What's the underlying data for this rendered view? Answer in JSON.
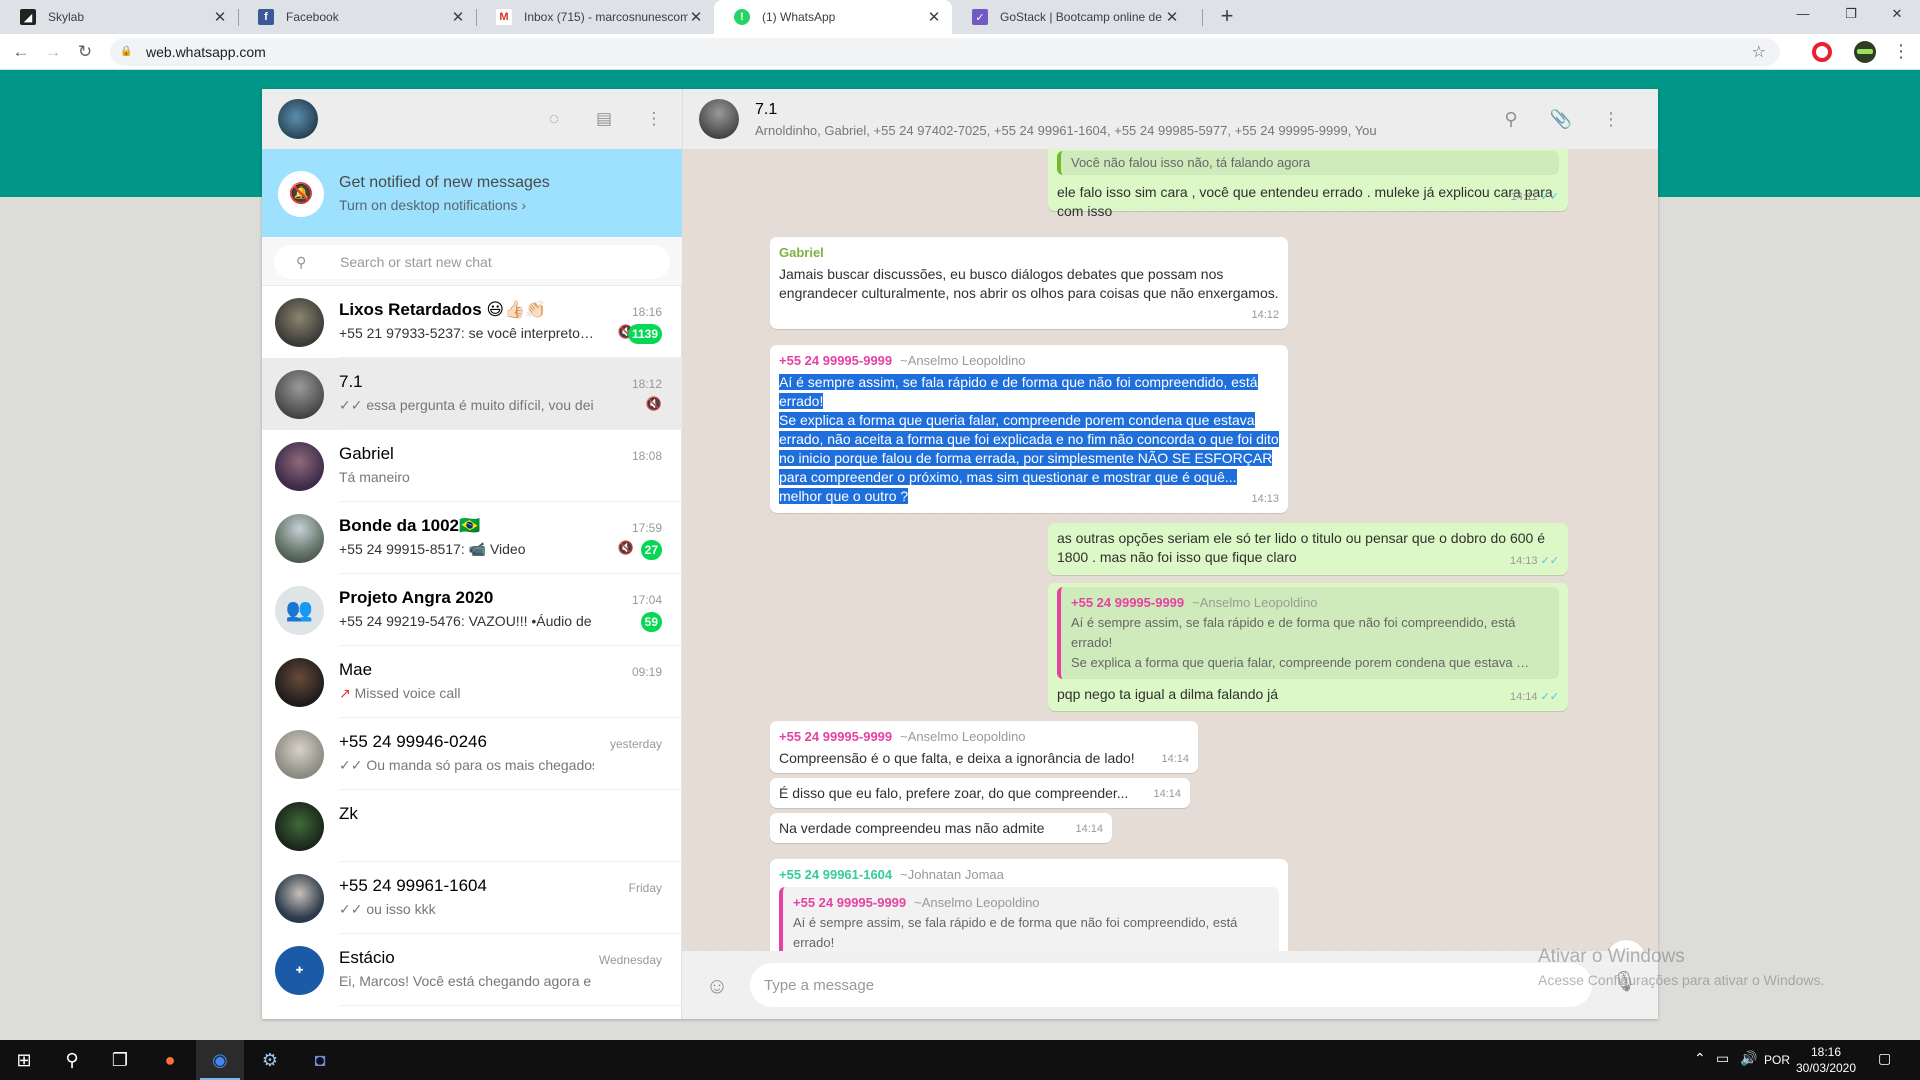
{
  "browser": {
    "tabs": [
      {
        "title": "Skylab",
        "favicon_color": "#222222",
        "favicon_char": "◢"
      },
      {
        "title": "Facebook",
        "favicon_color": "#3b5998",
        "favicon_char": "f"
      },
      {
        "title": "Inbox (715) - marcosnunescomer",
        "favicon_color": "#ffffff",
        "favicon_char": "M"
      },
      {
        "title": "(1) WhatsApp",
        "favicon_color": "#25d366",
        "favicon_char": "!"
      },
      {
        "title": "GoStack | Bootcamp online de N",
        "favicon_color": "#7159c1",
        "favicon_char": "✓"
      }
    ],
    "url": "web.whatsapp.com"
  },
  "sidebar": {
    "notification": {
      "title": "Get notified of new messages",
      "subtitle": "Turn on desktop notifications ›"
    },
    "search_placeholder": "Search or start new chat",
    "chats": [
      {
        "name": "Lixos Retardados 😃👍🏻👏🏻",
        "time": "18:16",
        "preview": "+55 21 97933-5237: se você interpreto…",
        "badge": "1139",
        "muted": true,
        "bold": true,
        "avatar_color": "#3b3a36"
      },
      {
        "name": "7.1",
        "time": "18:12",
        "preview": "✓✓ essa pergunta é muito difícil, vou deixar pa…",
        "badge": "",
        "muted": true,
        "bold": false,
        "avatar_color": "#6a6a6a"
      },
      {
        "name": "Gabriel",
        "time": "18:08",
        "preview": "Tá maneiro",
        "badge": "",
        "muted": false,
        "bold": false,
        "avatar_color": "#4b3a5a"
      },
      {
        "name": "Bonde da 1002🇧🇷",
        "time": "17:59",
        "preview": "+55 24 99915-8517: 📹 Video",
        "badge": "27",
        "muted": true,
        "bold": true,
        "avatar_color": "#7a8a7a"
      },
      {
        "name": "Projeto Angra 2020",
        "time": "17:04",
        "preview": "+55 24 99219-5476: VAZOU!!!   •Áudio de …",
        "badge": "59",
        "muted": false,
        "bold": true,
        "avatar_color": "#dfe5e7"
      },
      {
        "name": "Mae",
        "time": "09:19",
        "preview": "Missed voice call",
        "badge": "",
        "muted": false,
        "bold": false,
        "avatar_color": "#1c1c1c"
      },
      {
        "name": "+55 24 99946-0246",
        "time": "yesterday",
        "preview": "✓✓ Ou manda só para os mais chegados que voc…",
        "badge": "",
        "muted": false,
        "bold": false,
        "avatar_color": "#9aa1a8"
      },
      {
        "name": "Zk",
        "time": "",
        "preview": "",
        "badge": "",
        "muted": false,
        "bold": false,
        "avatar_color": "#2a3a2a"
      },
      {
        "name": "+55 24 99961-1604",
        "time": "Friday",
        "preview": "✓✓ ou isso kkk",
        "badge": "",
        "muted": false,
        "bold": false,
        "avatar_color": "#3a4a5a"
      },
      {
        "name": "Estácio",
        "time": "Wednesday",
        "preview": "Ei, Marcos!  Você está chegando agora e estamos…",
        "badge": "",
        "muted": false,
        "bold": false,
        "avatar_color": "#1b5aa6"
      }
    ]
  },
  "conversation": {
    "name": "7.1",
    "members": "Arnoldinho, Gabriel, +55 24 97402-7025, +55 24 99961-1604, +55 24 99985-5977, +55 24 99995-9999, You",
    "input_placeholder": "Type a message",
    "messages": {
      "m1": {
        "quote": "Você não falou isso não, tá falando agora",
        "text": "ele falo isso sim cara , você que entendeu errado . muleke já explicou cara para com isso",
        "time": "14:11"
      },
      "m2": {
        "sender": "Gabriel",
        "text": "Jamais buscar discussões, eu busco diálogos  debates que possam nos engrandecer culturalmente, nos abrir os olhos para coisas que não enxergamos.",
        "time": "14:12"
      },
      "m3": {
        "sender": "+55 24 99995-9999",
        "alias": "~Anselmo Leopoldino",
        "lines": [
          "Aí é sempre assim, se fala rápido e de forma que não foi compreendido, está errado!",
          "Se explica a forma que queria falar, compreende porem condena que estava errado, não aceita a forma que foi explicada e no fim não concorda o que foi dito no inicio porque falou de forma errada, por simplesmente NÃO SE ESFORÇAR para compreender o próximo, mas sim questionar e mostrar que é oquê... melhor que o outro ?"
        ],
        "time": "14:13"
      },
      "m4": {
        "text": "as outras opções seriam ele só ter lido o titulo ou pensar que o dobro do 600 é 1800 . mas não foi isso que fique claro",
        "time": "14:13"
      },
      "m5": {
        "quote_sender": "+55 24 99995-9999",
        "quote_alias": "~Anselmo Leopoldino",
        "quote_lines": [
          "Aí é sempre assim, se fala rápido e de forma que não foi compreendido, está errado!",
          "Se explica a forma que queria falar, compreende porem condena que estava …"
        ],
        "text": "pqp nego ta igual a dilma falando já",
        "time": "14:14"
      },
      "m6": {
        "sender": "+55 24 99995-9999",
        "alias": "~Anselmo Leopoldino",
        "text": "Compreensão é o que falta, e deixa a ignorância de lado!",
        "time": "14:14"
      },
      "m7": {
        "text": "É disso que eu falo, prefere zoar, do que compreender...",
        "time": "14:14"
      },
      "m8": {
        "text": "Na verdade compreendeu mas não admite",
        "time": "14:14"
      },
      "m9": {
        "sender": "+55 24 99961-1604",
        "alias": "~Johnatan Jomaa",
        "quote_sender": "+55 24 99995-9999",
        "quote_alias": "~Anselmo Leopoldino",
        "quote_text": "Aí é sempre assim, se fala rápido e de forma que não foi compreendido, está errado!"
      }
    }
  },
  "watermark": {
    "title": "Ativar o Windows",
    "subtitle": "Acesse Configurações para ativar o Windows."
  },
  "taskbar": {
    "lang": "POR",
    "time": "18:16",
    "date": "30/03/2020"
  }
}
